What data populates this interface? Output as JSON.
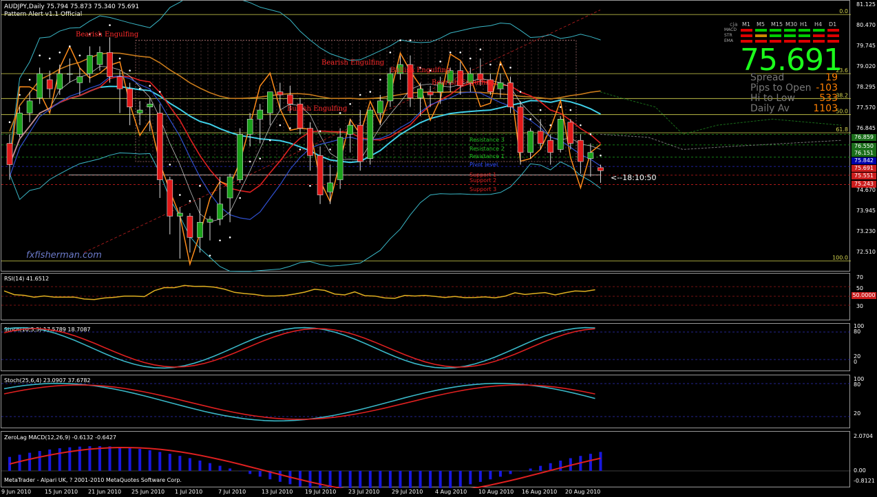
{
  "header": {
    "symbol_line": "AUDJPY,Daily  75.794 75.873 75.340 75.691",
    "indicator_line": "Pattern Alert v1.1 Official"
  },
  "price_scale": [
    "81.125",
    "80.470",
    "79.745",
    "79.020",
    "78.295",
    "77.570",
    "76.845",
    "76.120",
    "75.395",
    "74.670",
    "73.945",
    "73.230",
    "72.510"
  ],
  "price_boxes": [
    {
      "value": "76.859",
      "color": "#1a6e1a"
    },
    {
      "value": "76.550",
      "color": "#1a6e1a"
    },
    {
      "value": "76.151",
      "color": "#1a6e1a"
    },
    {
      "value": "75.842",
      "color": "#0000aa"
    },
    {
      "value": "75.691",
      "color": "#cc1d1d"
    },
    {
      "value": "75.551",
      "color": "#cc1d1d"
    },
    {
      "value": "75.243",
      "color": "#cc1d1d"
    }
  ],
  "fib_levels": [
    {
      "label": "0.0"
    },
    {
      "label": "23.6"
    },
    {
      "label": "38.2"
    },
    {
      "label": "50.0"
    },
    {
      "label": "61.8"
    },
    {
      "label": "100.0"
    }
  ],
  "signal_panel": {
    "title": "cja",
    "timeframes": [
      "M1",
      "M5",
      "M15",
      "M30",
      "H1",
      "H4",
      "D1"
    ],
    "rows": [
      "MACD",
      "STR",
      "EMA"
    ],
    "price": "75.691",
    "stats": [
      {
        "label": "Spread",
        "value": "19"
      },
      {
        "label": "Pips to Open",
        "value": "-103"
      },
      {
        "label": "Hi to Low",
        "value": "533"
      },
      {
        "label": "Daily Av",
        "value": "1103"
      }
    ]
  },
  "pattern_labels": [
    "Bearish Engulfing",
    "Bullish Engulfing",
    "Bearish Engulfing",
    "Bullish Engulfing",
    "Bearish Engulfing"
  ],
  "pivot_labels": [
    "Resistance 3",
    "Resistance 2",
    "Resistance 1",
    "Pivot level",
    "Support 1",
    "Support 2",
    "Support 3"
  ],
  "timer": "<--18:10:50",
  "watermark": "fxfisherman.com",
  "rsi": {
    "title": "RSI(14) 41.6512",
    "scale": [
      "70",
      "50",
      "30"
    ],
    "box": "50.0000"
  },
  "stoch1": {
    "title": "Stoch(10,3,3) 17.5789 18.7087",
    "scale": [
      "100",
      "80",
      "20",
      "0"
    ]
  },
  "stoch2": {
    "title": "Stoch(25,6,4) 23.0907 37.6782",
    "scale": [
      "100",
      "80",
      "20"
    ]
  },
  "macd": {
    "title": "ZeroLag MACD(12,26,9) -0.6132 -0.6427",
    "scale": [
      "2.0704",
      "0.00",
      "-0.8121"
    ]
  },
  "copyright": "MetaTrader - Alpari UK, ? 2001-2010 MetaQuotes Software Corp.",
  "dates": [
    "9 Jun 2010",
    "15 Jun 2010",
    "21 Jun 2010",
    "25 Jun 2010",
    "1 Jul 2010",
    "7 Jul 2010",
    "13 Jul 2010",
    "19 Jul 2010",
    "23 Jul 2010",
    "29 Jul 2010",
    "4 Aug 2010",
    "10 Aug 2010",
    "16 Aug 2010",
    "20 Aug 2010"
  ],
  "chart_data": {
    "type": "candlestick",
    "title": "AUDJPY,Daily",
    "ohlc_last": {
      "open": 75.794,
      "high": 75.873,
      "low": 75.34,
      "close": 75.691
    },
    "ylim": [
      72.51,
      81.125
    ],
    "candles": [
      [
        76.6,
        76.9,
        75.4,
        75.9
      ],
      [
        76.9,
        77.8,
        76.8,
        77.6
      ],
      [
        77.6,
        78.3,
        77.3,
        78.0
      ],
      [
        78.1,
        79.1,
        77.9,
        78.9
      ],
      [
        78.7,
        79.0,
        78.1,
        78.4
      ],
      [
        78.4,
        79.2,
        78.2,
        78.9
      ],
      [
        78.9,
        79.4,
        78.6,
        78.9
      ],
      [
        78.6,
        79.1,
        78.2,
        78.8
      ],
      [
        78.9,
        79.8,
        78.6,
        79.5
      ],
      [
        79.2,
        79.8,
        79.0,
        79.6
      ],
      [
        79.6,
        80.1,
        78.6,
        78.8
      ],
      [
        78.8,
        79.0,
        77.6,
        78.4
      ],
      [
        78.4,
        78.6,
        77.2,
        77.8
      ],
      [
        77.6,
        78.0,
        77.2,
        77.7
      ],
      [
        77.8,
        78.1,
        77.0,
        77.9
      ],
      [
        77.6,
        77.9,
        74.8,
        75.4
      ],
      [
        75.4,
        75.5,
        73.6,
        74.2
      ],
      [
        74.2,
        74.5,
        72.8,
        74.3
      ],
      [
        74.2,
        74.3,
        73.0,
        73.5
      ],
      [
        73.5,
        74.8,
        73.0,
        74.0
      ],
      [
        74.0,
        74.2,
        73.4,
        74.1
      ],
      [
        74.1,
        75.5,
        73.9,
        74.6
      ],
      [
        74.8,
        75.6,
        74.0,
        75.5
      ],
      [
        75.4,
        77.1,
        75.3,
        76.9
      ],
      [
        76.9,
        77.6,
        76.5,
        77.4
      ],
      [
        77.4,
        77.9,
        76.6,
        77.7
      ],
      [
        77.6,
        78.3,
        77.2,
        78.3
      ],
      [
        78.3,
        78.6,
        77.7,
        78.2
      ],
      [
        78.2,
        78.5,
        77.6,
        77.9
      ],
      [
        77.9,
        78.1,
        76.9,
        77.1
      ],
      [
        77.1,
        77.3,
        75.7,
        76.2
      ],
      [
        76.2,
        76.5,
        74.6,
        74.9
      ],
      [
        75.0,
        75.9,
        74.6,
        75.3
      ],
      [
        75.4,
        77.1,
        75.1,
        76.8
      ],
      [
        76.9,
        77.4,
        76.3,
        77.2
      ],
      [
        77.2,
        77.7,
        75.7,
        76.0
      ],
      [
        76.1,
        77.8,
        75.9,
        77.7
      ],
      [
        77.6,
        78.2,
        77.2,
        78.0
      ],
      [
        78.0,
        79.1,
        77.8,
        78.9
      ],
      [
        78.9,
        79.5,
        78.7,
        79.2
      ],
      [
        79.2,
        79.5,
        77.8,
        78.1
      ],
      [
        78.1,
        78.6,
        77.5,
        78.4
      ],
      [
        78.3,
        78.5,
        77.8,
        78.2
      ],
      [
        78.3,
        78.8,
        77.9,
        78.6
      ],
      [
        78.6,
        79.1,
        78.3,
        79.0
      ],
      [
        79.0,
        79.3,
        78.2,
        78.5
      ],
      [
        78.6,
        79.1,
        78.3,
        78.9
      ],
      [
        78.9,
        79.4,
        78.5,
        78.7
      ],
      [
        78.7,
        78.9,
        78.2,
        78.3
      ],
      [
        78.4,
        78.9,
        78.1,
        78.6
      ],
      [
        78.6,
        78.8,
        77.6,
        77.8
      ],
      [
        77.8,
        78.0,
        75.9,
        76.3
      ],
      [
        76.3,
        77.1,
        76.1,
        77.0
      ],
      [
        77.0,
        77.4,
        76.4,
        76.6
      ],
      [
        76.7,
        76.9,
        75.9,
        76.3
      ],
      [
        76.4,
        77.5,
        76.3,
        77.4
      ],
      [
        77.3,
        77.4,
        76.4,
        76.6
      ],
      [
        76.7,
        76.9,
        75.6,
        76.0
      ],
      [
        76.1,
        76.6,
        75.5,
        76.3
      ],
      [
        75.8,
        75.9,
        75.3,
        75.7
      ]
    ]
  }
}
